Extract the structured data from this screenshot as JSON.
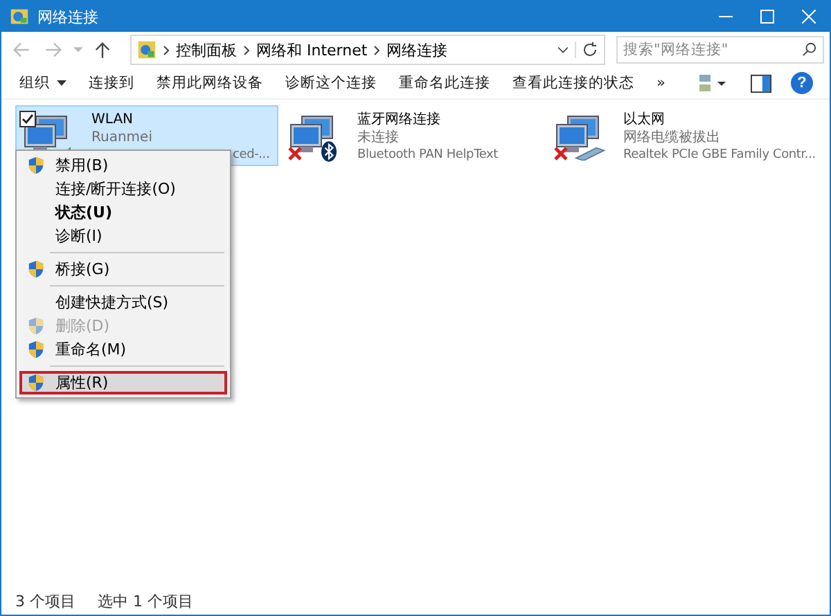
{
  "window": {
    "title": "网络连接"
  },
  "address": {
    "crumbs": [
      "控制面板",
      "网络和 Internet",
      "网络连接"
    ]
  },
  "search": {
    "placeholder": "搜索\"网络连接\""
  },
  "toolbar": {
    "items": [
      {
        "label": "组织",
        "dropdown": true
      },
      {
        "label": "连接到",
        "dropdown": false
      },
      {
        "label": "禁用此网络设备",
        "dropdown": false
      },
      {
        "label": "诊断这个连接",
        "dropdown": false
      },
      {
        "label": "重命名此连接",
        "dropdown": false
      },
      {
        "label": "查看此连接的状态",
        "dropdown": false
      },
      {
        "label": "»",
        "dropdown": false
      }
    ]
  },
  "connections": [
    {
      "name": "WLAN",
      "status": "Ruanmei",
      "device": "ced-...",
      "kind": "wifi",
      "connected": true,
      "selected": true,
      "checked": true
    },
    {
      "name": "蓝牙网络连接",
      "status": "未连接",
      "device": "Bluetooth PAN HelpText",
      "kind": "bluetooth",
      "connected": false,
      "selected": false,
      "checked": false
    },
    {
      "name": "以太网",
      "status": "网络电缆被拔出",
      "device": "Realtek PCIe GBE Family Contr...",
      "kind": "ethernet",
      "connected": false,
      "selected": false,
      "checked": false
    }
  ],
  "context_menu": {
    "items": [
      {
        "kind": "item",
        "label": "禁用(B)",
        "shield": true,
        "bold": false,
        "disabled": false,
        "selected": false
      },
      {
        "kind": "item",
        "label": "连接/断开连接(O)",
        "shield": false,
        "bold": false,
        "disabled": false,
        "selected": false
      },
      {
        "kind": "item",
        "label": "状态(U)",
        "shield": false,
        "bold": true,
        "disabled": false,
        "selected": false
      },
      {
        "kind": "item",
        "label": "诊断(I)",
        "shield": false,
        "bold": false,
        "disabled": false,
        "selected": false
      },
      {
        "kind": "separator"
      },
      {
        "kind": "item",
        "label": "桥接(G)",
        "shield": true,
        "bold": false,
        "disabled": false,
        "selected": false
      },
      {
        "kind": "separator"
      },
      {
        "kind": "item",
        "label": "创建快捷方式(S)",
        "shield": false,
        "bold": false,
        "disabled": false,
        "selected": false
      },
      {
        "kind": "item",
        "label": "删除(D)",
        "shield": true,
        "bold": false,
        "disabled": true,
        "selected": false
      },
      {
        "kind": "item",
        "label": "重命名(M)",
        "shield": true,
        "bold": false,
        "disabled": false,
        "selected": false
      },
      {
        "kind": "separator"
      },
      {
        "kind": "item",
        "label": "属性(R)",
        "shield": true,
        "bold": false,
        "disabled": false,
        "selected": true
      }
    ]
  },
  "help": {
    "label": "?"
  },
  "status_bar": {
    "count": "3 个项目",
    "selection": "选中 1 个项目"
  }
}
